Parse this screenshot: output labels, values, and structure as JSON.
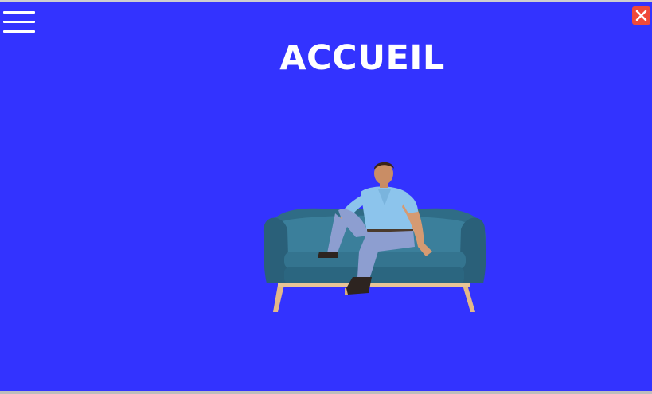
{
  "page": {
    "title": "ACCUEIL",
    "background_color": "#3333ff",
    "title_color": "#ffffff"
  },
  "menu_button": {
    "icon": "hamburger-menu-icon"
  },
  "close_button": {
    "icon": "close-icon",
    "color": "#f04a3a"
  },
  "hero_image": {
    "subject": "person-on-sofa-illustration"
  }
}
